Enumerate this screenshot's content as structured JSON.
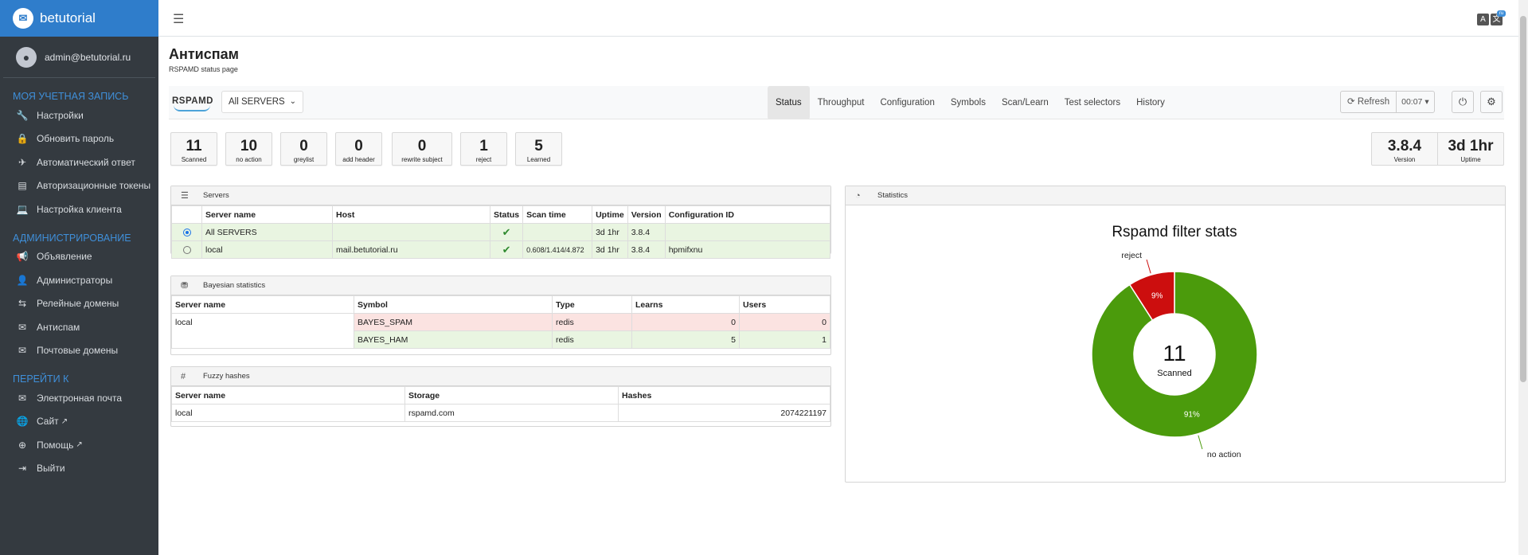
{
  "brand": {
    "name": "betutorial"
  },
  "user": {
    "email": "admin@betutorial.ru"
  },
  "sidebar": {
    "sections": [
      {
        "title": "МОЯ УЧЕТНАЯ ЗАПИСЬ",
        "items": [
          {
            "label": "Настройки",
            "icon": "wrench-icon"
          },
          {
            "label": "Обновить пароль",
            "icon": "lock-icon"
          },
          {
            "label": "Автоматический ответ",
            "icon": "plane-icon"
          },
          {
            "label": "Авторизационные токены",
            "icon": "token-icon"
          },
          {
            "label": "Настройка клиента",
            "icon": "laptop-icon"
          }
        ]
      },
      {
        "title": "АДМИНИСТРИРОВАНИЕ",
        "items": [
          {
            "label": "Объявление",
            "icon": "megaphone-icon"
          },
          {
            "label": "Администраторы",
            "icon": "user-icon"
          },
          {
            "label": "Релейные домены",
            "icon": "relay-icon"
          },
          {
            "label": "Антиспам",
            "icon": "antispam-icon"
          },
          {
            "label": "Почтовые домены",
            "icon": "envelope-icon"
          }
        ]
      },
      {
        "title": "ПЕРЕЙТИ К",
        "items": [
          {
            "label": "Электронная почта",
            "icon": "envelope-icon"
          },
          {
            "label": "Сайт",
            "icon": "globe-icon",
            "external": true
          },
          {
            "label": "Помощь",
            "icon": "lifebuoy-icon",
            "external": true
          },
          {
            "label": "Выйти",
            "icon": "logout-icon"
          }
        ]
      }
    ]
  },
  "page": {
    "title": "Антиспам",
    "subtitle": "RSPAMD status page"
  },
  "rspamd": {
    "logo_text": "RSPAMD",
    "server_select": "All SERVERS",
    "tabs": [
      "Status",
      "Throughput",
      "Configuration",
      "Symbols",
      "Scan/Learn",
      "Test selectors",
      "History"
    ],
    "active_tab": "Status",
    "refresh_label": "Refresh",
    "timer": "00:07"
  },
  "stats": [
    {
      "value": "11",
      "label": "Scanned"
    },
    {
      "value": "10",
      "label": "no action"
    },
    {
      "value": "0",
      "label": "greylist"
    },
    {
      "value": "0",
      "label": "add header"
    },
    {
      "value": "0",
      "label": "rewrite subject"
    },
    {
      "value": "1",
      "label": "reject"
    },
    {
      "value": "5",
      "label": "Learned"
    }
  ],
  "info": {
    "version": "3.8.4",
    "version_label": "Version",
    "uptime": "3d 1hr",
    "uptime_label": "Uptime"
  },
  "servers": {
    "title": "Servers",
    "headers": [
      "Server name",
      "Host",
      "Status",
      "Scan time",
      "Uptime",
      "Version",
      "Configuration ID"
    ],
    "rows": [
      {
        "name": "All SERVERS",
        "host": "",
        "scan_time": "",
        "uptime": "3d 1hr",
        "version": "3.8.4",
        "config_id": "",
        "selected": true
      },
      {
        "name": "local",
        "host": "mail.betutorial.ru",
        "scan_time": "0.608/1.414/4.872",
        "uptime": "3d 1hr",
        "version": "3.8.4",
        "config_id": "hpmifxnu",
        "selected": false
      }
    ]
  },
  "bayes": {
    "title": "Bayesian statistics",
    "headers": [
      "Server name",
      "Symbol",
      "Type",
      "Learns",
      "Users"
    ],
    "server": "local",
    "rows": [
      {
        "symbol": "BAYES_SPAM",
        "type": "redis",
        "learns": "0",
        "users": "0"
      },
      {
        "symbol": "BAYES_HAM",
        "type": "redis",
        "learns": "5",
        "users": "1"
      }
    ]
  },
  "fuzzy": {
    "title": "Fuzzy hashes",
    "headers": [
      "Server name",
      "Storage",
      "Hashes"
    ],
    "rows": [
      {
        "server": "local",
        "storage": "rspamd.com",
        "hashes": "2074221197"
      }
    ]
  },
  "statistics_panel": {
    "title": "Statistics"
  },
  "chart_data": {
    "type": "pie",
    "title": "Rspamd filter stats",
    "center_value": "11",
    "center_label": "Scanned",
    "slices": [
      {
        "label": "no action",
        "value": 10,
        "percent_label": "91%",
        "color": "#4b9b0c"
      },
      {
        "label": "reject",
        "value": 1,
        "percent_label": "9%",
        "color": "#cc0e0e"
      }
    ]
  }
}
